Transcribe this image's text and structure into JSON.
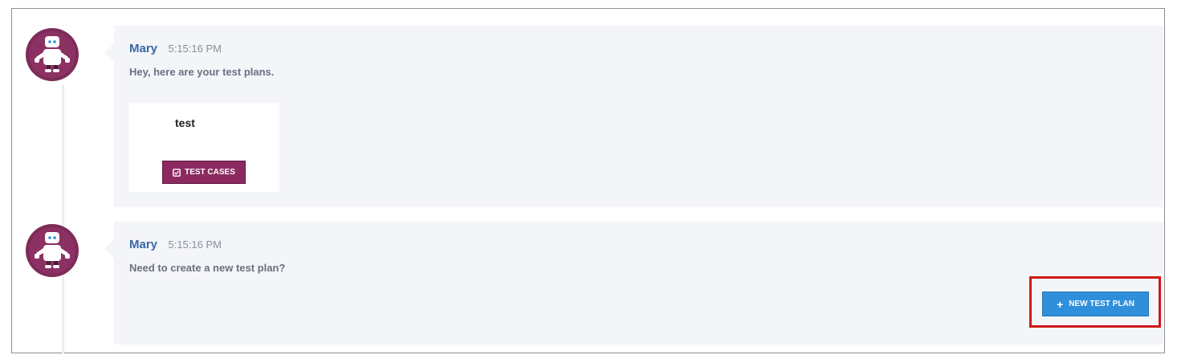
{
  "messages": [
    {
      "sender": "Mary",
      "time": "5:15:16 PM",
      "text": "Hey, here are your test plans.",
      "card": {
        "title": "test",
        "button_label": "TEST CASES"
      }
    },
    {
      "sender": "Mary",
      "time": "5:15:16 PM",
      "text": "Need to create a new test plan?",
      "button_label": "NEW TEST PLAN"
    }
  ],
  "colors": {
    "avatar_bg": "#7d2b57",
    "sender_name": "#3a67a6",
    "test_cases_button": "#8c2a5f",
    "new_test_plan_button": "#2f8fdb",
    "highlight": "#d01818",
    "bubble_bg": "#f4f5f9"
  },
  "icons": {
    "avatar": "robot-avatar-icon",
    "test_cases": "checkbox-icon",
    "new_test_plan": "plus-icon"
  }
}
